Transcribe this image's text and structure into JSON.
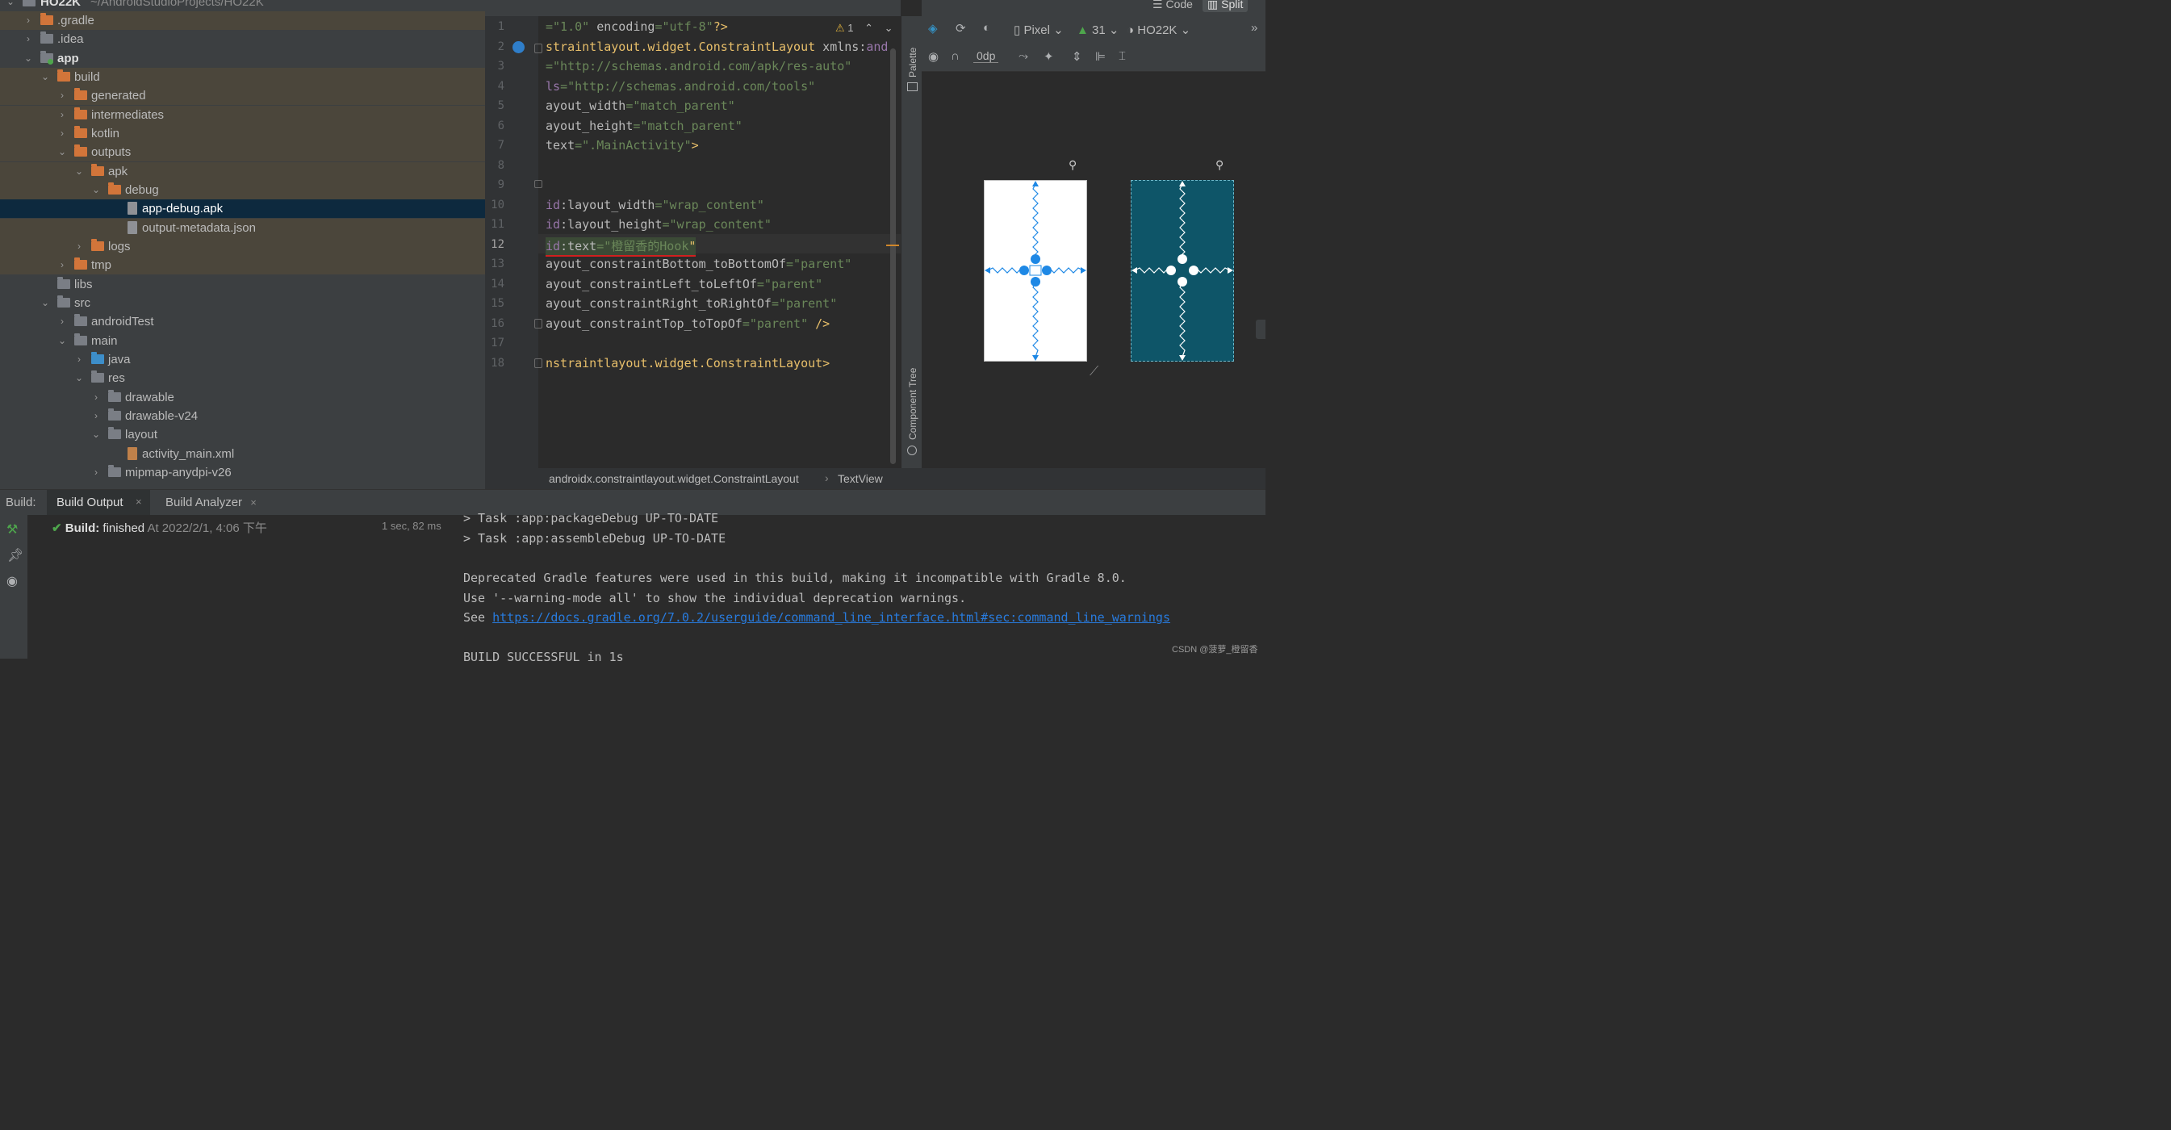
{
  "project": {
    "root_name": "HO22K",
    "root_path": "~/AndroidStudioProjects/HO22K",
    "items": [
      {
        "label": ".gradle"
      },
      {
        "label": ".idea"
      },
      {
        "label": "app"
      },
      {
        "label": "build"
      },
      {
        "label": "generated"
      },
      {
        "label": "intermediates"
      },
      {
        "label": "kotlin"
      },
      {
        "label": "outputs"
      },
      {
        "label": "apk"
      },
      {
        "label": "debug"
      },
      {
        "label": "app-debug.apk"
      },
      {
        "label": "output-metadata.json"
      },
      {
        "label": "logs"
      },
      {
        "label": "tmp"
      },
      {
        "label": "libs"
      },
      {
        "label": "src"
      },
      {
        "label": "androidTest"
      },
      {
        "label": "main"
      },
      {
        "label": "java"
      },
      {
        "label": "res"
      },
      {
        "label": "drawable"
      },
      {
        "label": "drawable-v24"
      },
      {
        "label": "layout"
      },
      {
        "label": "activity_main.xml"
      },
      {
        "label": "mipmap-anydpi-v26"
      }
    ]
  },
  "editor": {
    "warning_count": "1",
    "line_numbers": [
      "1",
      "2",
      "3",
      "4",
      "5",
      "6",
      "7",
      "8",
      "9",
      "10",
      "11",
      "12",
      "13",
      "14",
      "15",
      "16",
      "17",
      "18"
    ],
    "current_line": "12",
    "lines": {
      "l1a": "=\"1.0\"",
      "l1b": " encoding",
      "l1c": "=\"utf-8\"",
      "l1d": "?>",
      "l2a": "straintlayout.widget.ConstraintLayout",
      "l2b": " xmlns:",
      "l2c": "and",
      "l3a": "=\"http://schemas.android.com/apk/res-auto\"",
      "l4a": "ls",
      "l4b": "=\"http://schemas.android.com/tools\"",
      "l5a": "ayout_width",
      "l5b": "=\"match_parent\"",
      "l6a": "ayout_height",
      "l6b": "=\"match_parent\"",
      "l7a": "text",
      "l7b": "=\".MainActivity\"",
      "l7c": ">",
      "l10a": "id",
      "l10b": ":layout_width",
      "l10c": "=\"wrap_content\"",
      "l11a": "id",
      "l11b": ":layout_height",
      "l11c": "=\"wrap_content\"",
      "l12a": "id",
      "l12b": ":text",
      "l12c": "=\"",
      "l12d": "橙留香的Hook",
      "l12e": "\"",
      "l13a": "ayout_constraintBottom_toBottomOf",
      "l13b": "=\"parent\"",
      "l14a": "ayout_constraintLeft_toLeftOf",
      "l14b": "=\"parent\"",
      "l15a": "ayout_constraintRight_toRightOf",
      "l15b": "=\"parent\"",
      "l16a": "ayout_constraintTop_toTopOf",
      "l16b": "=\"parent\"",
      "l16c": " />",
      "l18a": "nstraintlayout.widget.ConstraintLayout>"
    }
  },
  "side_tabs": {
    "palette": "Palette",
    "component_tree": "Component Tree"
  },
  "view_modes": {
    "code": "Code",
    "split": "Split"
  },
  "design_toolbar": {
    "device": "Pixel",
    "api": "31",
    "theme": "HO22K",
    "margin": "0dp"
  },
  "breadcrumb": {
    "items": [
      "androidx.constraintlayout.widget.ConstraintLayout",
      "TextView"
    ]
  },
  "build": {
    "label": "Build:",
    "tabs": [
      "Build Output",
      "Build Analyzer"
    ],
    "status_bold": "Build:",
    "status_text": "finished",
    "status_time": "At 2022/2/1, 4:06 下午",
    "duration": "1 sec, 82 ms",
    "output": {
      "line0": "> Task :app:packageDebug UP-TO-DATE",
      "line1": "> Task :app:assembleDebug UP-TO-DATE",
      "line2": "Deprecated Gradle features were used in this build, making it incompatible with Gradle 8.0.",
      "line3": "Use '--warning-mode all' to show the individual deprecation warnings.",
      "line4_prefix": "See ",
      "line4_link": "https://docs.gradle.org/7.0.2/userguide/command_line_interface.html#sec:command_line_warnings",
      "line5": "BUILD SUCCESSFUL in 1s"
    }
  },
  "watermark": "CSDN @菠萝_橙留香",
  "colors": {
    "accent_blue": "#1e88e5",
    "selection": "#0d293e",
    "blueprint": "#0e5568"
  }
}
